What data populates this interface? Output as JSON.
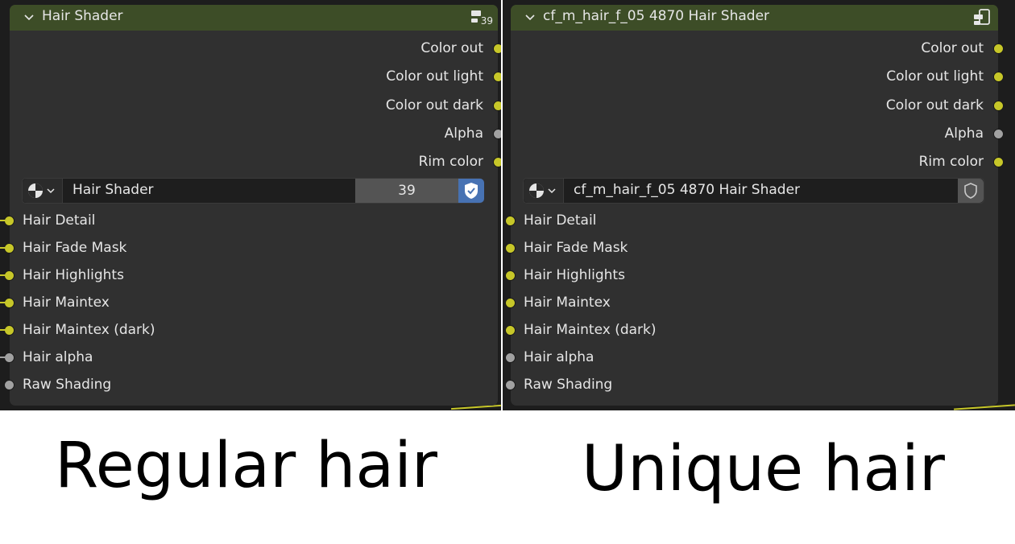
{
  "panels": {
    "regular": {
      "header_title": "Hair Shader",
      "user_badge": "39",
      "outputs": [
        {
          "label": "Color out",
          "socket": "yellow"
        },
        {
          "label": "Color out light",
          "socket": "yellow"
        },
        {
          "label": "Color out dark",
          "socket": "yellow"
        },
        {
          "label": "Alpha",
          "socket": "gray"
        },
        {
          "label": "Rim color",
          "socket": "yellow"
        }
      ],
      "datablock": {
        "icon": "node-tree-icon",
        "name": "Hair Shader",
        "users": "39",
        "fake_user": "shield-check-icon"
      },
      "inputs": [
        {
          "label": "Hair Detail",
          "socket": "yellow"
        },
        {
          "label": "Hair Fade Mask",
          "socket": "yellow"
        },
        {
          "label": "Hair Highlights",
          "socket": "yellow"
        },
        {
          "label": "Hair Maintex",
          "socket": "yellow"
        },
        {
          "label": "Hair Maintex (dark)",
          "socket": "yellow"
        },
        {
          "label": "Hair alpha",
          "socket": "gray"
        },
        {
          "label": "Raw Shading",
          "socket": "gray"
        }
      ]
    },
    "unique": {
      "header_title": "cf_m_hair_f_05 4870 Hair Shader",
      "outputs": [
        {
          "label": "Color out",
          "socket": "yellow"
        },
        {
          "label": "Color out light",
          "socket": "yellow"
        },
        {
          "label": "Color out dark",
          "socket": "yellow"
        },
        {
          "label": "Alpha",
          "socket": "gray"
        },
        {
          "label": "Rim color",
          "socket": "yellow"
        }
      ],
      "datablock": {
        "icon": "node-tree-icon",
        "name": "cf_m_hair_f_05 4870 Hair Shader",
        "fake_user": "shield-icon"
      },
      "inputs": [
        {
          "label": "Hair Detail",
          "socket": "yellow"
        },
        {
          "label": "Hair Fade Mask",
          "socket": "yellow"
        },
        {
          "label": "Hair Highlights",
          "socket": "yellow"
        },
        {
          "label": "Hair Maintex",
          "socket": "yellow"
        },
        {
          "label": "Hair Maintex (dark)",
          "socket": "yellow"
        },
        {
          "label": "Hair alpha",
          "socket": "gray"
        },
        {
          "label": "Raw Shading",
          "socket": "gray"
        }
      ]
    }
  },
  "captions": {
    "left": "Regular hair",
    "right": "Unique hair"
  },
  "colors": {
    "header": "#3d4d27",
    "node_body": "#303030",
    "socket_yellow": "#c7c729",
    "socket_gray": "#a1a1a1",
    "accent_blue": "#4772b3"
  }
}
